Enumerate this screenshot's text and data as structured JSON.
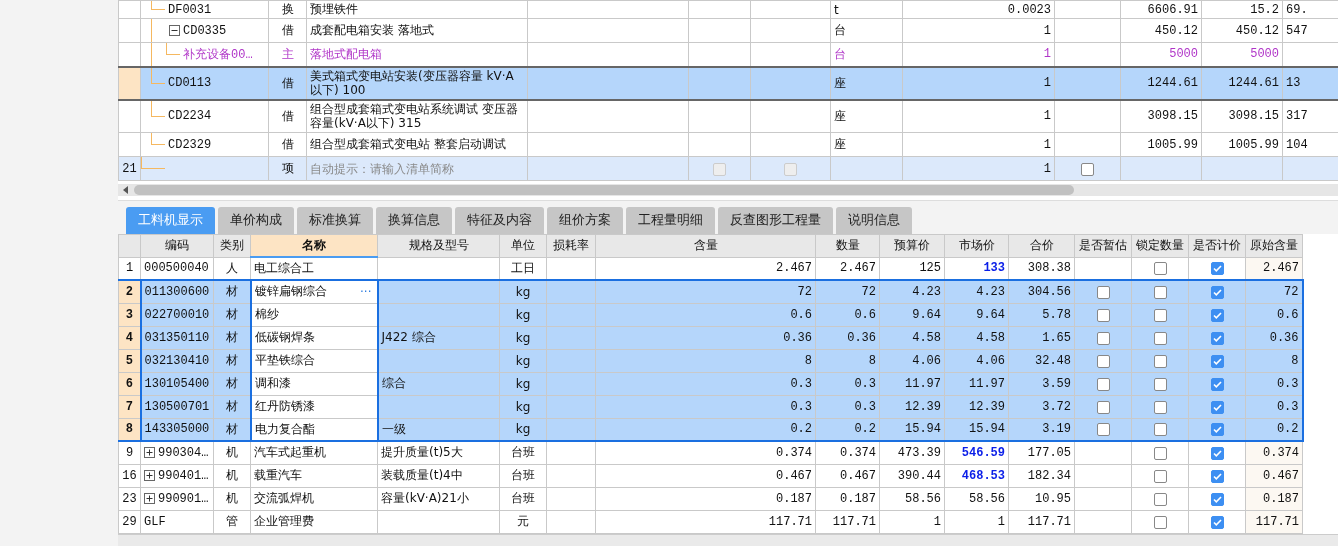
{
  "upper_grid": {
    "rows": [
      {
        "kind": "quota",
        "code": "DF0031",
        "type": "换",
        "name": "预埋铁件",
        "unit": "t",
        "qty": "0.0023",
        "price": "6606.91",
        "total": "15.2",
        "column_13": "69.",
        "selected": false,
        "children": []
      },
      {
        "kind": "quota",
        "code": "CD0335",
        "type": "借",
        "name": "成套配电箱安装 落地式",
        "unit": "台",
        "qty": "1",
        "price": "450.12",
        "total": "450.12",
        "column_13": "547",
        "selected": false,
        "expanded": true,
        "children": [
          {
            "kind": "equipment",
            "code": "补充设备00…",
            "type": "主",
            "name": "落地式配电箱",
            "unit": "台",
            "qty": "1",
            "price": "5000",
            "total": "5000",
            "selected": false
          }
        ]
      },
      {
        "kind": "quota",
        "code": "CD0113",
        "type": "借",
        "name": "美式箱式变电站安装(变压器容量 kV·A以下) 100",
        "unit": "座",
        "qty": "1",
        "price": "1244.61",
        "total": "1244.61",
        "column_13": "13",
        "selected": true,
        "children": []
      },
      {
        "kind": "quota",
        "code": "CD2234",
        "type": "借",
        "name": "组合型成套箱式变电站系统调试 变压器容量(kV·A以下) 315",
        "unit": "座",
        "qty": "1",
        "price": "3098.15",
        "total": "3098.15",
        "column_13": "317",
        "selected": false,
        "children": []
      },
      {
        "kind": "quota",
        "code": "CD2329",
        "type": "借",
        "name": "组合型成套箱式变电站 整套启动调试",
        "unit": "座",
        "qty": "1",
        "price": "1005.99",
        "total": "1005.99",
        "column_13": "104",
        "selected": false,
        "children": []
      }
    ],
    "new_row": {
      "number": "21",
      "type": "项",
      "placeholder": "自动提示：请输入清单简称",
      "qty": "1",
      "flags": [
        {
          "checked": false,
          "disabled": true
        },
        {
          "checked": false,
          "disabled": true
        },
        {
          "checked": false,
          "disabled": false
        }
      ]
    }
  },
  "tabs": [
    {
      "label": "工料机显示",
      "selected": true
    },
    {
      "label": "单价构成",
      "selected": false
    },
    {
      "label": "标准换算",
      "selected": false
    },
    {
      "label": "换算信息",
      "selected": false
    },
    {
      "label": "特征及内容",
      "selected": false
    },
    {
      "label": "组价方案",
      "selected": false
    },
    {
      "label": "工程量明细",
      "selected": false
    },
    {
      "label": "反查图形工程量",
      "selected": false
    },
    {
      "label": "说明信息",
      "selected": false
    }
  ],
  "lower_grid": {
    "columns": [
      {
        "label": "编码",
        "selected": false
      },
      {
        "label": "类别",
        "selected": false
      },
      {
        "label": "名称",
        "selected": true
      },
      {
        "label": "规格及型号",
        "selected": false
      },
      {
        "label": "单位",
        "selected": false
      },
      {
        "label": "损耗率",
        "selected": false
      },
      {
        "label": "含量",
        "selected": false
      },
      {
        "label": "数量",
        "selected": false
      },
      {
        "label": "预算价",
        "selected": false
      },
      {
        "label": "市场价",
        "selected": false
      },
      {
        "label": "合价",
        "selected": false
      },
      {
        "label": "是否暂估",
        "selected": false
      },
      {
        "label": "锁定数量",
        "selected": false
      },
      {
        "label": "是否计价",
        "selected": false
      },
      {
        "label": "原始含量",
        "selected": false
      }
    ],
    "rows": [
      {
        "number": "1",
        "code": "000500040",
        "category": "人",
        "name": "电工综合工",
        "spec": "",
        "unit": "工日",
        "content": "2.467",
        "quantity": "2.467",
        "budget_price": "125",
        "market_price": "133",
        "market_changed": true,
        "total": "308.38",
        "locked": false,
        "priced": true,
        "original": "2.467",
        "selected": false
      },
      {
        "number": "2",
        "code": "011300600",
        "category": "材",
        "name": "镀锌扁钢综合",
        "more_button": "···",
        "spec": "",
        "unit": "kg",
        "content": "72",
        "quantity": "72",
        "budget_price": "4.23",
        "market_price": "4.23",
        "market_changed": false,
        "total": "304.56",
        "estimate": false,
        "locked": false,
        "priced": true,
        "original": "72",
        "selected": true
      },
      {
        "number": "3",
        "code": "022700010",
        "category": "材",
        "name": "棉纱",
        "spec": "",
        "unit": "kg",
        "content": "0.6",
        "quantity": "0.6",
        "budget_price": "9.64",
        "market_price": "9.64",
        "market_changed": false,
        "total": "5.78",
        "estimate": false,
        "locked": false,
        "priced": true,
        "original": "0.6",
        "selected": true
      },
      {
        "number": "4",
        "code": "031350110",
        "category": "材",
        "name": "低碳钢焊条",
        "spec": "J422 综合",
        "unit": "kg",
        "content": "0.36",
        "quantity": "0.36",
        "budget_price": "4.58",
        "market_price": "4.58",
        "market_changed": false,
        "total": "1.65",
        "estimate": false,
        "locked": false,
        "priced": true,
        "original": "0.36",
        "selected": true
      },
      {
        "number": "5",
        "code": "032130410",
        "category": "材",
        "name": "平垫铁综合",
        "spec": "",
        "unit": "kg",
        "content": "8",
        "quantity": "8",
        "budget_price": "4.06",
        "market_price": "4.06",
        "market_changed": false,
        "total": "32.48",
        "estimate": false,
        "locked": false,
        "priced": true,
        "original": "8",
        "selected": true
      },
      {
        "number": "6",
        "code": "130105400",
        "category": "材",
        "name": "调和漆",
        "spec": "综合",
        "unit": "kg",
        "content": "0.3",
        "quantity": "0.3",
        "budget_price": "11.97",
        "market_price": "11.97",
        "market_changed": false,
        "total": "3.59",
        "estimate": false,
        "locked": false,
        "priced": true,
        "original": "0.3",
        "selected": true
      },
      {
        "number": "7",
        "code": "130500701",
        "category": "材",
        "name": "红丹防锈漆",
        "spec": "",
        "unit": "kg",
        "content": "0.3",
        "quantity": "0.3",
        "budget_price": "12.39",
        "market_price": "12.39",
        "market_changed": false,
        "total": "3.72",
        "estimate": false,
        "locked": false,
        "priced": true,
        "original": "0.3",
        "selected": true
      },
      {
        "number": "8",
        "code": "143305000",
        "category": "材",
        "name": "电力复合酯",
        "spec": "一级",
        "unit": "kg",
        "content": "0.2",
        "quantity": "0.2",
        "budget_price": "15.94",
        "market_price": "15.94",
        "market_changed": false,
        "total": "3.19",
        "estimate": false,
        "locked": false,
        "priced": true,
        "original": "0.2",
        "selected": true
      },
      {
        "number": "9",
        "code": "990304…",
        "expanded": false,
        "category": "机",
        "name": "汽车式起重机",
        "spec": "提升质量(t)5大",
        "unit": "台班",
        "content": "0.374",
        "quantity": "0.374",
        "budget_price": "473.39",
        "market_price": "546.59",
        "market_changed": true,
        "total": "177.05",
        "locked": false,
        "priced": true,
        "original": "0.374",
        "selected": false
      },
      {
        "number": "16",
        "code": "990401…",
        "expanded": false,
        "category": "机",
        "name": "载重汽车",
        "spec": "装载质量(t)4中",
        "unit": "台班",
        "content": "0.467",
        "quantity": "0.467",
        "budget_price": "390.44",
        "market_price": "468.53",
        "market_changed": true,
        "total": "182.34",
        "locked": false,
        "priced": true,
        "original": "0.467",
        "selected": false
      },
      {
        "number": "23",
        "code": "990901…",
        "expanded": false,
        "category": "机",
        "name": "交流弧焊机",
        "spec": "容量(kV·A)21小",
        "unit": "台班",
        "content": "0.187",
        "quantity": "0.187",
        "budget_price": "58.56",
        "market_price": "58.56",
        "market_changed": false,
        "total": "10.95",
        "locked": false,
        "priced": true,
        "original": "0.187",
        "selected": false
      },
      {
        "number": "29",
        "code": "GLF",
        "category": "管",
        "name": "企业管理费",
        "spec": "",
        "unit": "元",
        "content": "117.71",
        "quantity": "117.71",
        "budget_price": "1",
        "market_price": "1",
        "market_changed": false,
        "total": "117.71",
        "locked": false,
        "priced": true,
        "original": "117.71",
        "selected": false
      }
    ]
  }
}
